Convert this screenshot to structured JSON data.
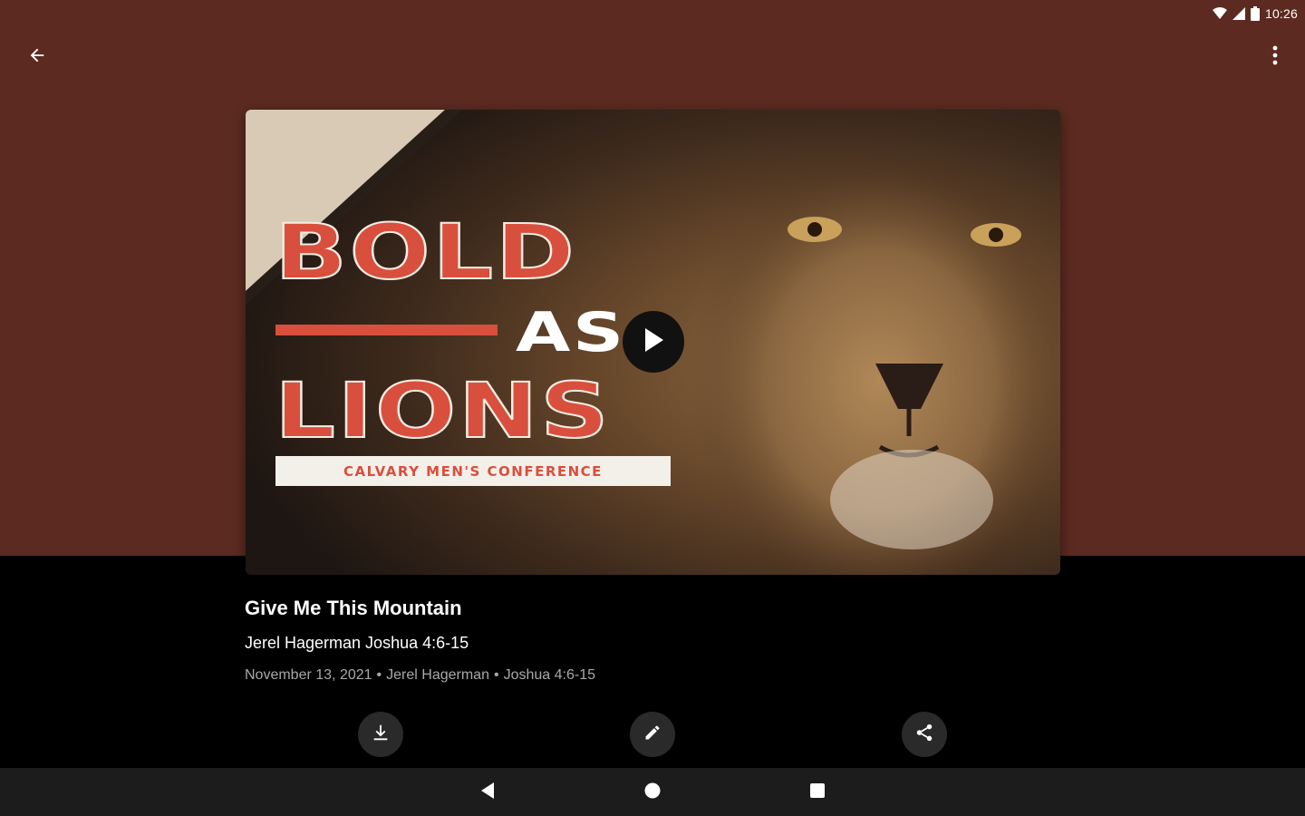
{
  "status_bar": {
    "time": "10:26",
    "icons": [
      "wifi-icon",
      "cell-signal-icon",
      "battery-icon"
    ]
  },
  "app_bar": {
    "icons": [
      "back-arrow-icon",
      "more-vert-icon"
    ]
  },
  "artwork": {
    "line1": "BOLD",
    "line2": "AS",
    "line3": "LIONS",
    "banner": "CALVARY MEN'S CONFERENCE",
    "play_icon": "play-icon"
  },
  "sermon": {
    "title": "Give Me This Mountain",
    "subtitle": "Jerel Hagerman Joshua 4:6-15",
    "date": "November 13, 2021",
    "separator": "•",
    "speaker": "Jerel Hagerman",
    "passage": "Joshua 4:6-15"
  },
  "actions": {
    "icons": [
      "download-icon",
      "edit-icon",
      "share-icon"
    ]
  },
  "nav_bar": {
    "icons": [
      "nav-back-icon",
      "nav-home-icon",
      "nav-recents-icon"
    ]
  },
  "colors": {
    "header_background": "#5c2a20",
    "accent_red": "#d94f3d",
    "page_background": "#000000",
    "meta_text": "#a8a8a8"
  }
}
